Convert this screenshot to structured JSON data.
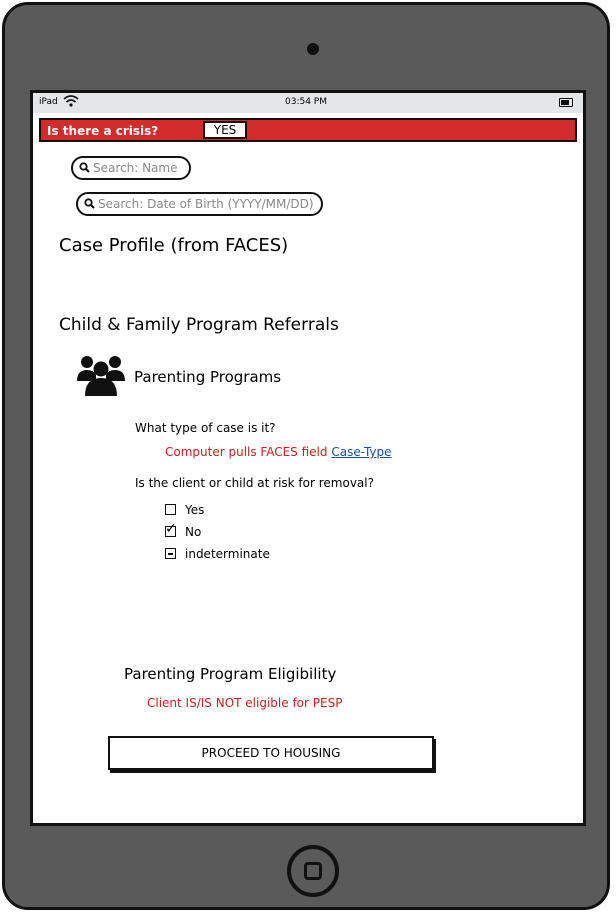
{
  "status_bar": {
    "device": "iPad",
    "time": "03:54 PM"
  },
  "crisis": {
    "label": "Is there a crisis?",
    "value": "YES"
  },
  "search_name": {
    "placeholder": "Search: Name"
  },
  "search_dob": {
    "placeholder": "Search: Date of Birth (YYYY/MM/DD)"
  },
  "case_profile": {
    "title": "Case Profile (from FACES)"
  },
  "referrals": {
    "title": "Child & Family Program Referrals",
    "program_icon": "people-group-icon",
    "program_title": "Parenting Programs",
    "case_type_question": "What type of case is it?",
    "case_type_note": "Computer pulls FACES field",
    "case_type_link": "Case-Type",
    "risk_question": "Is the client or child at risk for removal?",
    "options": [
      {
        "label": "Yes",
        "state": "unchecked"
      },
      {
        "label": "No",
        "state": "checked"
      },
      {
        "label": "indeterminate",
        "state": "indeterminate"
      }
    ]
  },
  "eligibility": {
    "title": "Parenting Program Eligibility",
    "note": "Client IS/IS NOT eligible for PESP"
  },
  "proceed_button": {
    "label": "PROCEED TO HOUSING"
  },
  "colors": {
    "crisis_red": "#d32a2a",
    "note_red": "#c62020",
    "link_blue": "#1a4ea0",
    "frame_gray": "#5a5a5a"
  }
}
